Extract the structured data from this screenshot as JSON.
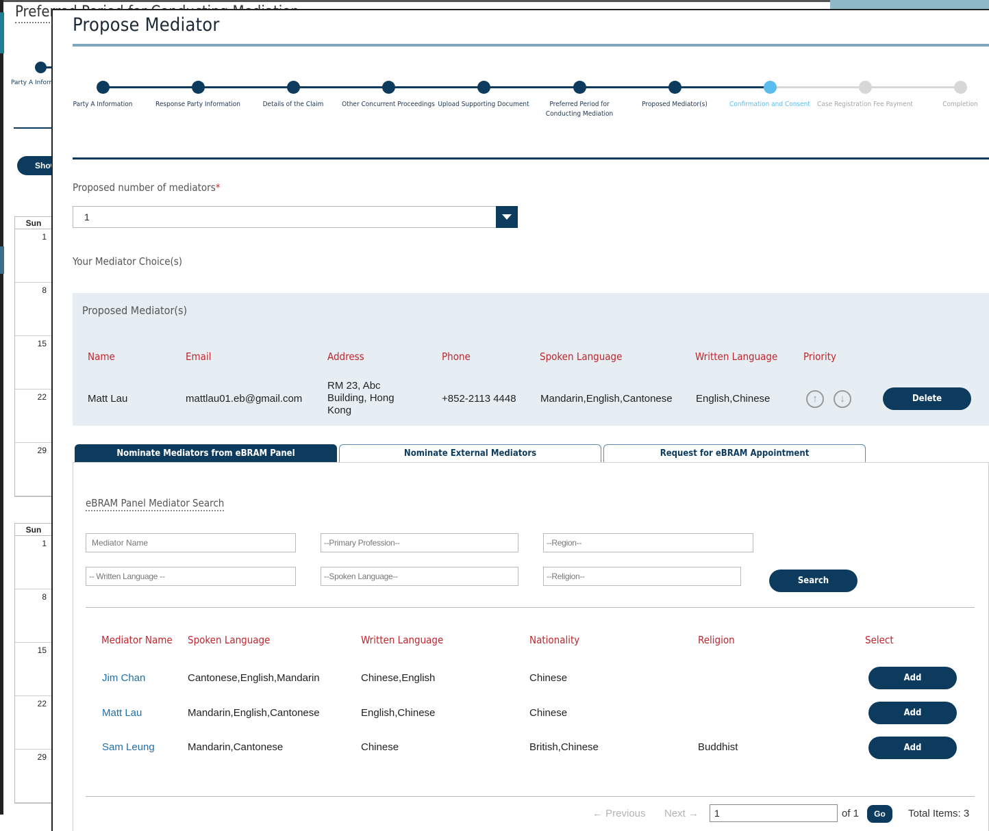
{
  "background": {
    "title": "Preferred Period for Conducting Mediation",
    "step_label": "Party A Information",
    "show_button": "Show",
    "calendars": [
      {
        "day_header": "Sun",
        "dates": [
          "1",
          "8",
          "15",
          "22",
          "29"
        ]
      },
      {
        "day_header": "Sun",
        "dates": [
          "1",
          "8",
          "15",
          "22",
          "29"
        ]
      }
    ]
  },
  "modal": {
    "title": "Propose Mediator",
    "steps": [
      {
        "label": "Party A Information",
        "state": "done"
      },
      {
        "label": "Response Party Information",
        "state": "done"
      },
      {
        "label": "Details of the Claim",
        "state": "done"
      },
      {
        "label": "Other Concurrent Proceedings",
        "state": "done"
      },
      {
        "label": "Upload Supporting Document",
        "state": "done"
      },
      {
        "label": "Preferred Period for Conducting Mediation",
        "state": "done"
      },
      {
        "label": "Proposed Mediator(s)",
        "state": "done"
      },
      {
        "label": "Confirmation and Consent",
        "state": "current"
      },
      {
        "label": "Case Registration Fee Payment",
        "state": "future"
      },
      {
        "label": "Completion",
        "state": "future"
      }
    ],
    "proposed_number": {
      "label": "Proposed number of mediators",
      "required_mark": "*",
      "value": "1"
    },
    "choices_heading": "Your Mediator Choice(s)",
    "proposed_panel": {
      "title": "Proposed Mediator(s)",
      "headers": [
        "Name",
        "Email",
        "Address",
        "Phone",
        "Spoken Language",
        "Written Language",
        "Priority"
      ],
      "rows": [
        {
          "name": "Matt Lau",
          "email": "mattlau01.eb@gmail.com",
          "address": "RM 23, Abc Building, Hong Kong",
          "phone": "+852-2113 4448",
          "spoken": "Mandarin,English,Cantonese",
          "written": "English,Chinese",
          "delete_label": "Delete"
        }
      ]
    },
    "tabs": [
      {
        "label": "Nominate Mediators from eBRAM Panel",
        "active": true
      },
      {
        "label": "Nominate External Mediators",
        "active": false
      },
      {
        "label": "Request for eBRAM Appointment",
        "active": false
      }
    ],
    "search": {
      "title": "eBRAM Panel Mediator Search",
      "mediator_name_placeholder": "Mediator Name",
      "primary_profession": "--Primary Profession--",
      "region": "--Region--",
      "written_language": "-- Written Language --",
      "spoken_language": "--Spoken Language--",
      "religion": "--Religion--",
      "search_label": "Search"
    },
    "results": {
      "headers": [
        "Mediator Name",
        "Spoken Language",
        "Written Language",
        "Nationality",
        "Religion",
        "Select"
      ],
      "rows": [
        {
          "name": "Jim Chan",
          "spoken": "Cantonese,English,Mandarin",
          "written": "Chinese,English",
          "nationality": "Chinese",
          "religion": "",
          "action": "Add"
        },
        {
          "name": "Matt Lau",
          "spoken": "Mandarin,English,Cantonese",
          "written": "English,Chinese",
          "nationality": "Chinese",
          "religion": "",
          "action": "Add"
        },
        {
          "name": "Sam Leung",
          "spoken": "Mandarin,Cantonese",
          "written": "Chinese",
          "nationality": "British,Chinese",
          "religion": "Buddhist",
          "action": "Add"
        }
      ]
    },
    "pagination": {
      "previous": "← Previous",
      "next": "Next →",
      "page_value": "1",
      "of_label": "of 1",
      "go_label": "Go",
      "total_label": "Total Items: 3"
    }
  },
  "colors": {
    "primary": "#0d3b5e",
    "current_step": "#5bbcf0",
    "future_step": "#d7d7d7",
    "header_red": "#c0262d",
    "link_blue": "#1f6fa8",
    "panel_bg": "#e6eef3"
  }
}
